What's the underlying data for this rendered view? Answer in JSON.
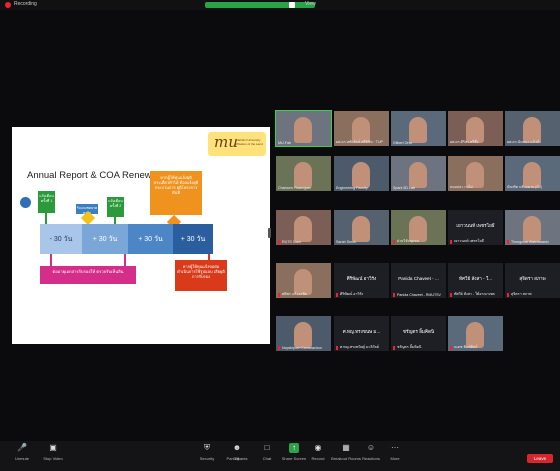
{
  "top_bar": {
    "recording_label": "Recording",
    "view_label": "View"
  },
  "slide": {
    "logo_text": "mu",
    "logo_subtext": "Mahidol University Wisdom of the Land",
    "title": "Annual Report & COA Renewal",
    "reminder_1": "แจ้งเตือน ครั้งที่ 1",
    "receive_report": "รับแจงชดยาตตราย",
    "reminder_2": "แจ้งเตือน ครั้งที่ 2",
    "orange_box": "หากผู้ให้ทุนแจ้งยุติ ประเดี๋ยวทำได้ ต้องแจ้งยุติกระบวนการ ยุติโครงการทันที",
    "bar_1": "- 30 วัน",
    "bar_2": "+ 30 วัน",
    "bar_3": "+ 30 วัน",
    "bar_4": "+ 30 วัน",
    "pink_box": "ต่ออายุเอกสารรับรองให้ ตรวจรับเห็นสิน",
    "red_box": "หากผู้ให้ทุนแจ้งขอต่อ ดำเนินการใช้รูปแบบ เสียยุติการรับรอง"
  },
  "participants": [
    {
      "name": "MU-Fab",
      "type": "video",
      "muted": false,
      "speaking": true
    },
    {
      "name": "ผศ.ดร.หทัยรัตน์ ศรีพิชิต · TUP",
      "type": "video",
      "muted": false
    },
    {
      "name": "Gilbert Ortiz",
      "type": "video",
      "muted": false
    },
    {
      "name": "ผศ.ดร.ศิริพร ศรีพึ่ง",
      "type": "video",
      "muted": false
    },
    {
      "name": "ผศ.ดร.นันทนา แก้วกิ่ง",
      "type": "video",
      "muted": false
    },
    {
      "name": "Chamorn Phanngam",
      "type": "video",
      "muted": false
    },
    {
      "name": "Engineering Faculty",
      "type": "video",
      "muted": false
    },
    {
      "name": "Spark 5D Lab",
      "type": "video",
      "muted": false
    },
    {
      "name": "หมอปลา กอไผ่",
      "type": "video",
      "muted": false
    },
    {
      "name": "บัณฑิต กลับกลาย (บัว)",
      "type": "video",
      "muted": false
    },
    {
      "name": "RUTS Siam",
      "type": "video",
      "muted": true
    },
    {
      "name": "Sarah Smith",
      "type": "video",
      "muted": false
    },
    {
      "name": "ฝ่ายวิจัยชุมชน",
      "type": "video",
      "muted": true
    },
    {
      "name": "เยาวนนท์ เพชรโยธี",
      "type": "text",
      "caption": "เยาวนนท์ เพชรโยธี",
      "muted": true
    },
    {
      "name": "Thongchai Watcharasin",
      "type": "video",
      "muted": true
    },
    {
      "name": "ศศิพร แก้วอรพิม",
      "type": "video",
      "muted": true
    },
    {
      "name": "ศิริพัฒน์ อาวิรัง",
      "type": "text",
      "caption": "ศิริพัฒน์ อาวิรัง",
      "muted": true
    },
    {
      "name": "Panida Chaveet - RMUTSV",
      "type": "text",
      "caption": "Panida Chaveet - ...",
      "muted": true
    },
    {
      "name": "ทัศวีย์ สังสา - ใต้อาณาเขต",
      "type": "text",
      "caption": "ทัศวีย์ สังสา - ใ...",
      "muted": true
    },
    {
      "name": "สุจิตรา สภาพ",
      "type": "text",
      "caption": "สุจิตรา สภาพ",
      "muted": true
    },
    {
      "name": "Nopsiriporn Kamarachon",
      "type": "video",
      "muted": true
    },
    {
      "name": "ศ.ทญ.ทรงขนิษฐ์ มะลิวัลย์",
      "type": "text",
      "caption": "ศ.ทญ.ทรงขนษ ม...",
      "muted": true
    },
    {
      "name": "ชรัญตร ลิ้มคิดนิ",
      "type": "text",
      "caption": "ชรัญตร ลิ้มคิดนิ",
      "muted": true
    },
    {
      "name": "นเดช พิมพ์ศิลป์",
      "type": "video",
      "muted": true
    }
  ],
  "toolbar": [
    {
      "name": "unmute",
      "label": "Unmute",
      "icon": "microphone-off-icon"
    },
    {
      "name": "stop-video",
      "label": "Stop Video",
      "icon": "camera-icon"
    },
    {
      "name": "security",
      "label": "Security",
      "icon": "shield-icon"
    },
    {
      "name": "participants",
      "label": "Participants",
      "icon": "participants-icon",
      "count": "24"
    },
    {
      "name": "chat",
      "label": "Chat",
      "icon": "chat-icon"
    },
    {
      "name": "share-screen",
      "label": "Share Screen",
      "icon": "share-screen-icon"
    },
    {
      "name": "record",
      "label": "Record",
      "icon": "record-icon"
    },
    {
      "name": "breakout-rooms",
      "label": "Breakout Rooms",
      "icon": "breakout-rooms-icon"
    },
    {
      "name": "reactions",
      "label": "Reactions",
      "icon": "reactions-icon"
    },
    {
      "name": "more",
      "label": "More",
      "icon": "more-icon"
    }
  ],
  "leave_label": "Leave",
  "colors": {
    "accent_green": "#2aa24a",
    "leave_red": "#d6272f",
    "slide_blue": "#3a7fc0",
    "slide_orange": "#f0921e",
    "slide_pink": "#d42d8a"
  }
}
